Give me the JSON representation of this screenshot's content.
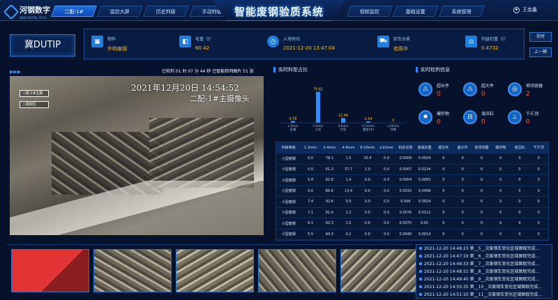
{
  "app": {
    "logo_text": "河钢数字",
    "logo_sub": "HBIS DIGITAL TECH",
    "title": "智能废钢验质系统",
    "user": "王金鑫"
  },
  "nav_left": [
    {
      "label": "二配-1#",
      "active": true
    },
    {
      "label": "监控大屏",
      "active": false
    },
    {
      "label": "历史判级",
      "active": false
    },
    {
      "label": "手动判级",
      "active": false
    }
  ],
  "nav_right": [
    {
      "label": "视频监控"
    },
    {
      "label": "基础设置"
    },
    {
      "label": "系统管理"
    }
  ],
  "plate": "冀DUTIP",
  "info": [
    {
      "label": "物料",
      "value": "外购废钢",
      "icon": "cube-icon"
    },
    {
      "label": "毛重（t）",
      "value": "60.42",
      "icon": "box-icon"
    },
    {
      "label": "入场时间",
      "value": "2021-12-20 13:47:04",
      "icon": "clock-icon"
    },
    {
      "label": "卸车全景",
      "value": "验质中",
      "icon": "truck-icon"
    },
    {
      "label": "判级扣重（t）",
      "value": "0.4732",
      "icon": "scale-icon"
    }
  ],
  "side_buttons": {
    "realtime": "实时",
    "prev": "上一辆"
  },
  "camera": {
    "status": "已检判 01 时 07 分 44 秒 已智能检判图片 51 张",
    "date": "2021年12月20日  14:54:52",
    "name": "二配-1#主摄像头",
    "tag1": "二配-1#主摄",
    "tag2": "二配卸区",
    "stream_url_label": ""
  },
  "chart_panel": {
    "title": "实时料型占比"
  },
  "chart_data": {
    "type": "bar",
    "categories": [
      "1-2mm\n轻薄",
      "2-4mm\n小型",
      "4-6mm\n中型",
      "6-10mm\n重型(中)",
      "≥10mm\n特厚"
    ],
    "values": [
      4.58,
      79.81,
      12.46,
      3.54,
      0
    ],
    "value_labels": [
      "4.58",
      "79.81",
      "12.46",
      "3.54",
      "0"
    ],
    "ylim": [
      0,
      90
    ],
    "color": "#2f8cff"
  },
  "alarm_panel": {
    "title": "实时检判信息"
  },
  "alarms": [
    {
      "label": "超长件",
      "count": "0",
      "icon": "warning-icon"
    },
    {
      "label": "超大件",
      "count": "0",
      "icon": "warning-icon"
    },
    {
      "label": "密闭容器",
      "count": "2",
      "icon": "target-icon"
    },
    {
      "label": "爆炸物",
      "count": "0",
      "icon": "bomb-icon"
    },
    {
      "label": "液压缸",
      "count": "0",
      "icon": "cylinder-icon"
    },
    {
      "label": "千斤顶",
      "count": "0",
      "icon": "jack-icon"
    }
  ],
  "table": {
    "columns": [
      "判级等级",
      "1-2mm",
      "2-4mm",
      "4-6mm",
      "6-10mm",
      "≥10mm",
      "扣杂比例",
      "金属扣重",
      "超长件",
      "超大件",
      "密闭容器",
      "爆炸物",
      "液压缸",
      "千斤顶"
    ],
    "rows": [
      [
        "小型废钢",
        "0.0",
        "78.1",
        "1.5",
        "20.4",
        "0.0",
        "0.0009",
        "0.0024",
        "0",
        "0",
        "0",
        "0",
        "0",
        "0"
      ],
      [
        "小型废钢",
        "0.0",
        "61.2",
        "37.7",
        "1.0",
        "0.0",
        "0.0007",
        "0.0134",
        "0",
        "0",
        "0",
        "0",
        "0",
        "0"
      ],
      [
        "小型废钢",
        "5.8",
        "92.8",
        "1.4",
        "0.0",
        "0.0",
        "0.0054",
        "0.0093",
        "0",
        "0",
        "0",
        "0",
        "0",
        "0"
      ],
      [
        "小型废钢",
        "0.0",
        "86.6",
        "13.4",
        "0.0",
        "0.0",
        "0.0015",
        "0.0098",
        "0",
        "0",
        "0",
        "0",
        "0",
        "0"
      ],
      [
        "小型废钢",
        "7.4",
        "92.6",
        "0.0",
        "0.0",
        "0.0",
        "0.006",
        "0.0024",
        "0",
        "0",
        "0",
        "0",
        "0",
        "0"
      ],
      [
        "小型废钢",
        "7.1",
        "91.6",
        "1.2",
        "0.0",
        "0.0",
        "0.0076",
        "0.0112",
        "0",
        "0",
        "0",
        "0",
        "0",
        "0"
      ],
      [
        "小型废钢",
        "6.1",
        "92.3",
        "1.5",
        "0.0",
        "0.0",
        "0.0075",
        "0.01",
        "0",
        "0",
        "0",
        "0",
        "0",
        "0"
      ],
      [
        "小型废钢",
        "5.5",
        "94.3",
        "0.2",
        "0.0",
        "0.0",
        "0.0046",
        "0.0014",
        "0",
        "0",
        "0",
        "0",
        "0",
        "0"
      ]
    ]
  },
  "logs": [
    "2021-12-20 14:48:23 第__5__次废钢车变化区域图取完成...",
    "2021-12-20 14:47:19 第__6__次废钢车变化区域图取完成...",
    "2021-12-20 14:48:33 第__7__次废钢车变化区域图取完成...",
    "2021-12-20 14:48:51 第__8__次废钢车变化区域图取完成...",
    "2021-12-20 14:49:40 第__9__次废钢车变化区域图取完成...",
    "2021-12-20 14:50:35 第__10__次废钢车变化区域图取完成...",
    "2021-12-20 14:51:10 第__11__次废钢车变化区域图取完成..."
  ]
}
